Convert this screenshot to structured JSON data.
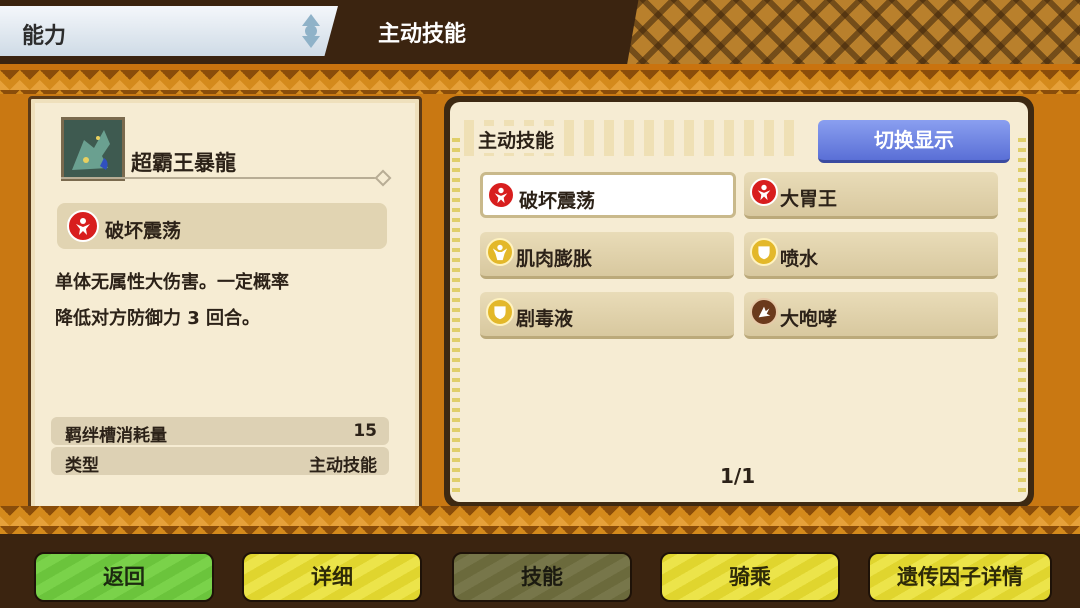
{
  "header": {
    "category": "能力",
    "section_title": "主动技能"
  },
  "left": {
    "monster_name": "超霸王暴龍",
    "selected_skill": {
      "label": "破坏震荡",
      "icon": "red-shockwave-icon"
    },
    "description_lines": [
      "单体无属性大伤害。一定概率",
      "降低对方防御力 3 回合。"
    ],
    "stats": [
      {
        "key": "羁绊槽消耗量",
        "value": "15"
      },
      {
        "key": "类型",
        "value": "主动技能"
      }
    ]
  },
  "right": {
    "panel_title": "主动技能",
    "switch_label": "切换显示",
    "skills": [
      {
        "label": "破坏震荡",
        "icon": "red-shockwave-icon",
        "selected": true
      },
      {
        "label": "大胃王",
        "icon": "red-glutton-icon",
        "selected": false
      },
      {
        "label": "肌肉膨胀",
        "icon": "yellow-muscle-icon",
        "selected": false
      },
      {
        "label": "喷水",
        "icon": "yellow-shield-icon",
        "selected": false
      },
      {
        "label": "剧毒液",
        "icon": "yellow-shield-icon",
        "selected": false
      },
      {
        "label": "大咆哮",
        "icon": "brown-roar-icon",
        "selected": false
      }
    ],
    "page_indicator": "1/1"
  },
  "nav": {
    "back": "返回",
    "details": "详细",
    "skills": "技能",
    "ride": "骑乘",
    "genes": "遗传因子详情"
  },
  "colors": {
    "accent_blue": "#6a80e0",
    "nav_green": "#6bc43c",
    "nav_yellow": "#e0d52e",
    "nav_active": "#6b6a3c",
    "icon_red": "#d81e1e",
    "icon_yellow": "#e3b82a",
    "icon_brown": "#6b3a1c"
  }
}
